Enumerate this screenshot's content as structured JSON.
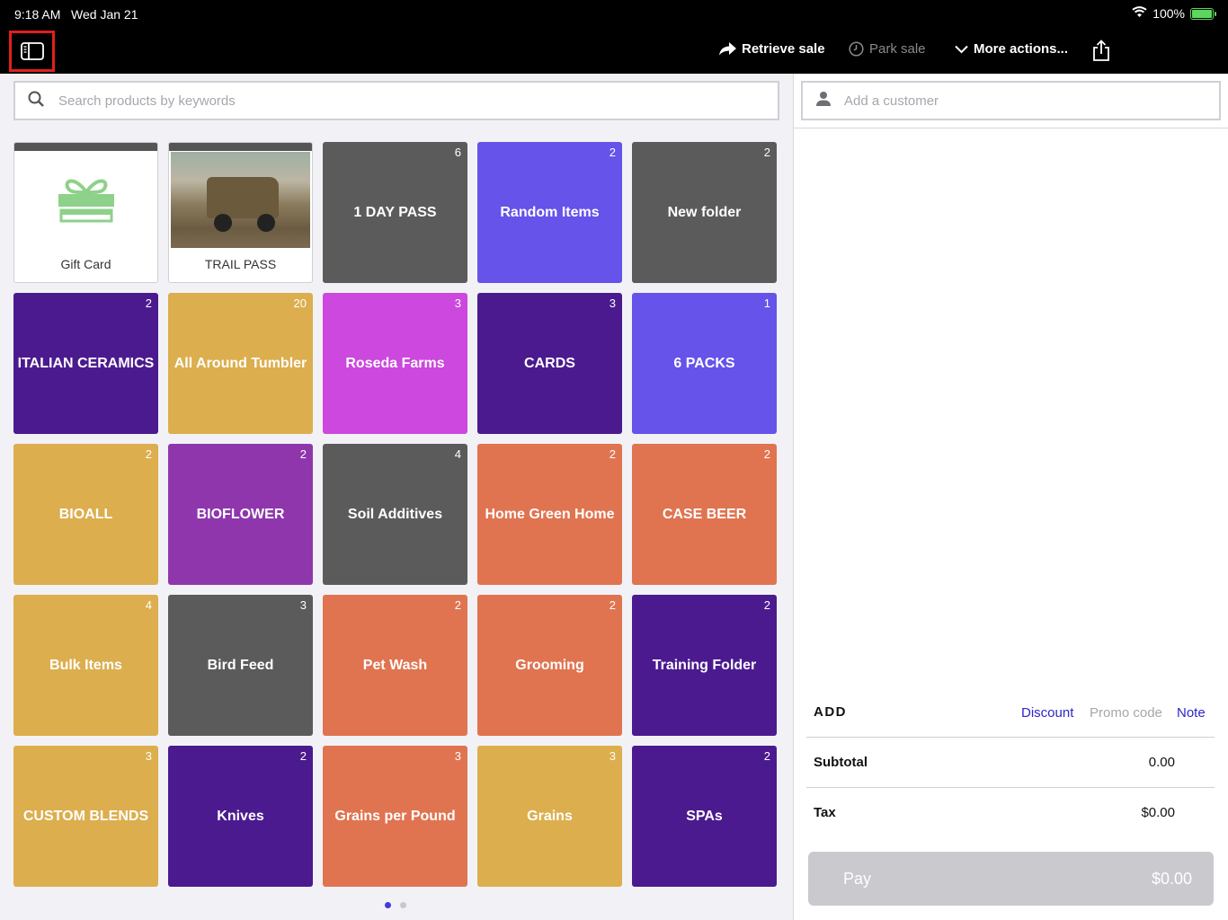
{
  "status": {
    "time": "9:18 AM",
    "date": "Wed Jan 21",
    "battery": "100%"
  },
  "toolbar": {
    "retrieve": "Retrieve sale",
    "park": "Park sale",
    "more": "More actions..."
  },
  "search": {
    "placeholder": "Search products by keywords"
  },
  "tiles": [
    {
      "label": "Gift Card",
      "type": "gift"
    },
    {
      "label": "TRAIL PASS",
      "type": "photo"
    },
    {
      "label": "1 DAY PASS",
      "count": "6",
      "color": "#5b5b5b"
    },
    {
      "label": "Random Items",
      "count": "2",
      "color": "#6553ea"
    },
    {
      "label": "New folder",
      "count": "2",
      "color": "#5b5b5b"
    },
    {
      "label": "ITALIAN CERAMICS",
      "count": "2",
      "color": "#4b1a8f"
    },
    {
      "label": "All Around Tumbler",
      "count": "20",
      "color": "#dcae4e"
    },
    {
      "label": "Roseda Farms",
      "count": "3",
      "color": "#cc48de"
    },
    {
      "label": "CARDS",
      "count": "3",
      "color": "#4b1a8f"
    },
    {
      "label": "6 PACKS",
      "count": "1",
      "color": "#6553ea"
    },
    {
      "label": "BIOALL",
      "count": "2",
      "color": "#dcae4e"
    },
    {
      "label": "BIOFLOWER",
      "count": "2",
      "color": "#8f36ad"
    },
    {
      "label": "Soil Additives",
      "count": "4",
      "color": "#5b5b5b"
    },
    {
      "label": "Home Green Home",
      "count": "2",
      "color": "#e07450"
    },
    {
      "label": "CASE BEER",
      "count": "2",
      "color": "#e07450"
    },
    {
      "label": "Bulk Items",
      "count": "4",
      "color": "#dcae4e"
    },
    {
      "label": "Bird Feed",
      "count": "3",
      "color": "#5b5b5b"
    },
    {
      "label": "Pet Wash",
      "count": "2",
      "color": "#e07450"
    },
    {
      "label": "Grooming",
      "count": "2",
      "color": "#e07450"
    },
    {
      "label": "Training Folder",
      "count": "2",
      "color": "#4b1a8f"
    },
    {
      "label": "CUSTOM BLENDS",
      "count": "3",
      "color": "#dcae4e"
    },
    {
      "label": "Knives",
      "count": "2",
      "color": "#4b1a8f"
    },
    {
      "label": "Grains per Pound",
      "count": "3",
      "color": "#e07450"
    },
    {
      "label": "Grains",
      "count": "3",
      "color": "#dcae4e"
    },
    {
      "label": "SPAs",
      "count": "2",
      "color": "#4b1a8f"
    }
  ],
  "pager": {
    "active_color": "#3d3bd9",
    "inactive_color": "#c7c7cc"
  },
  "customer": {
    "placeholder": "Add a customer"
  },
  "cart": {
    "add": "ADD",
    "discount": "Discount",
    "promo": "Promo code",
    "note": "Note",
    "subtotal_label": "Subtotal",
    "subtotal_value": "0.00",
    "tax_label": "Tax",
    "tax_value": "$0.00",
    "pay_label": "Pay",
    "pay_amount": "$0.00"
  }
}
